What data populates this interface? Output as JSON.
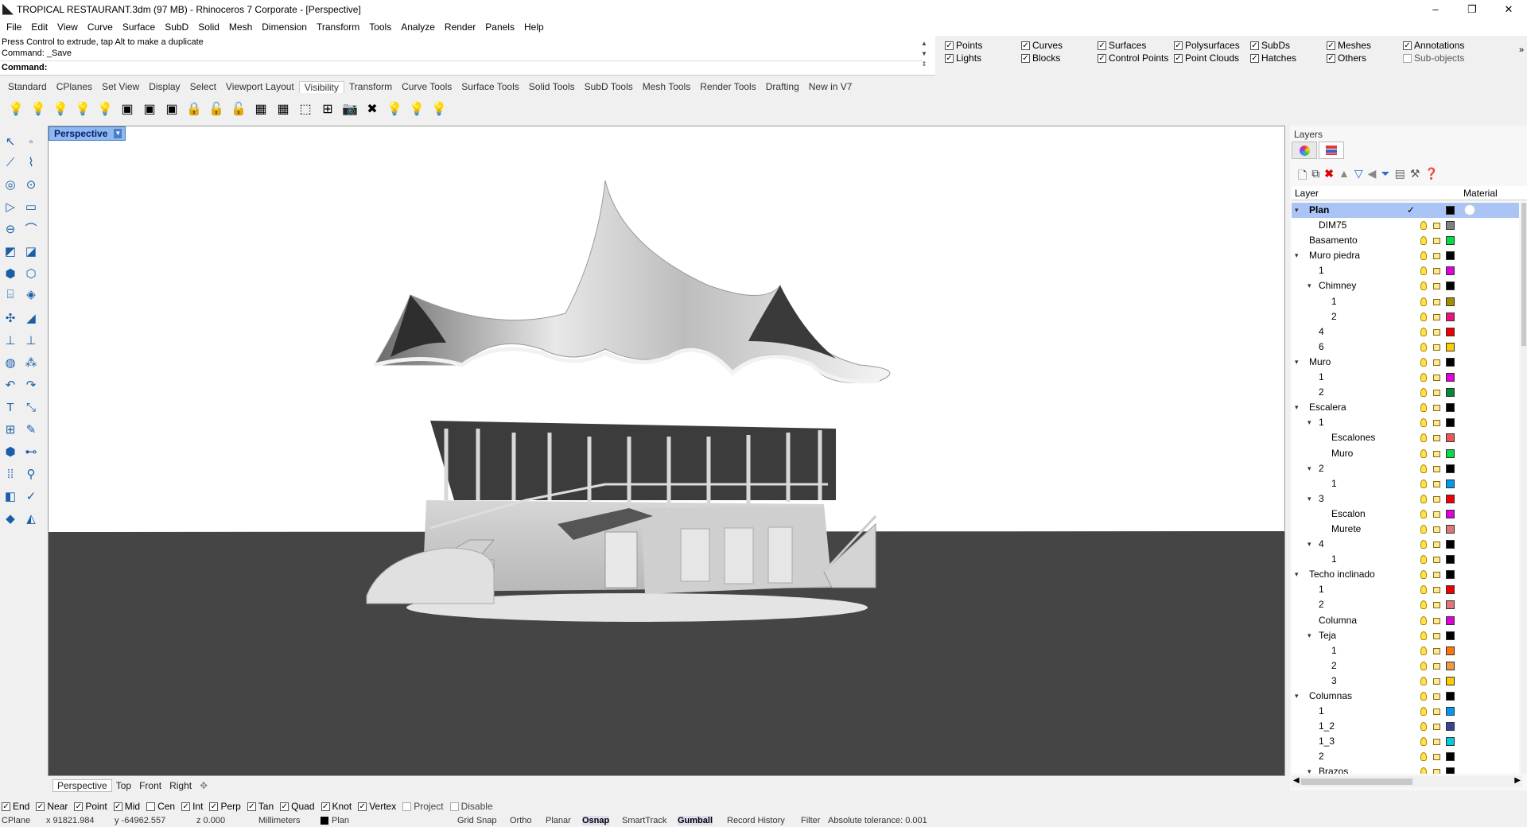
{
  "window": {
    "title": "TROPICAL RESTAURANT.3dm (97 MB) - Rhinoceros 7 Corporate - [Perspective]",
    "minimize": "–",
    "maximize": "❐",
    "close": "✕"
  },
  "menu": [
    "File",
    "Edit",
    "View",
    "Curve",
    "Surface",
    "SubD",
    "Solid",
    "Mesh",
    "Dimension",
    "Transform",
    "Tools",
    "Analyze",
    "Render",
    "Panels",
    "Help"
  ],
  "command": {
    "line1": "Press Control to extrude, tap Alt to make a duplicate",
    "line2": "Command: _Save",
    "prompt": "Command:"
  },
  "select_filter": {
    "items": [
      {
        "label": "Points",
        "checked": true
      },
      {
        "label": "Lights",
        "checked": true
      },
      {
        "label": "Curves",
        "checked": true
      },
      {
        "label": "Blocks",
        "checked": true
      },
      {
        "label": "Surfaces",
        "checked": true
      },
      {
        "label": "Control Points",
        "checked": true
      },
      {
        "label": "Polysurfaces",
        "checked": true
      },
      {
        "label": "Point Clouds",
        "checked": true
      },
      {
        "label": "SubDs",
        "checked": true
      },
      {
        "label": "Hatches",
        "checked": true
      },
      {
        "label": "Meshes",
        "checked": true
      },
      {
        "label": "Others",
        "checked": true
      },
      {
        "label": "Annotations",
        "checked": true
      },
      {
        "label": "Sub-objects",
        "checked": false
      }
    ],
    "more": "»"
  },
  "toolbar_tabs": [
    "Standard",
    "CPlanes",
    "Set View",
    "Display",
    "Select",
    "Viewport Layout",
    "Visibility",
    "Transform",
    "Curve Tools",
    "Surface Tools",
    "Solid Tools",
    "SubD Tools",
    "Mesh Tools",
    "Render Tools",
    "Drafting",
    "New in V7"
  ],
  "active_toolbar_tab": "Visibility",
  "viewport": {
    "name": "Perspective",
    "tabs": [
      "Perspective",
      "Top",
      "Front",
      "Right"
    ],
    "add_tab": "✥"
  },
  "osnaps": [
    {
      "label": "End",
      "checked": true
    },
    {
      "label": "Near",
      "checked": true
    },
    {
      "label": "Point",
      "checked": true
    },
    {
      "label": "Mid",
      "checked": true
    },
    {
      "label": "Cen",
      "checked": false
    },
    {
      "label": "Int",
      "checked": true
    },
    {
      "label": "Perp",
      "checked": true
    },
    {
      "label": "Tan",
      "checked": true
    },
    {
      "label": "Quad",
      "checked": true
    },
    {
      "label": "Knot",
      "checked": true
    },
    {
      "label": "Vertex",
      "checked": true
    },
    {
      "label": "Project",
      "checked": false
    },
    {
      "label": "Disable",
      "checked": false
    }
  ],
  "status": {
    "cplane": "CPlane",
    "x": "x 91821.984",
    "y": "y -64962.557",
    "z": "z 0.000",
    "units": "Millimeters",
    "layer": "Plan",
    "grid_snap": "Grid Snap",
    "ortho": "Ortho",
    "planar": "Planar",
    "osnap": "Osnap",
    "smarttrack": "SmartTrack",
    "gumball": "Gumball",
    "record_history": "Record History",
    "filter": "Filter",
    "tolerance": "Absolute tolerance: 0.001"
  },
  "layers_panel": {
    "title": "Layers",
    "col_layer": "Layer",
    "col_material": "Material",
    "rows": [
      {
        "name": "Plan",
        "level": 0,
        "toggle": "▾",
        "color": "#000000",
        "selected": true
      },
      {
        "name": "DIM75",
        "level": 1,
        "toggle": "",
        "color": "#808080"
      },
      {
        "name": "Basamento",
        "level": 0,
        "toggle": "",
        "color": "#00dd44"
      },
      {
        "name": "Muro piedra",
        "level": 0,
        "toggle": "▾",
        "color": "#000000"
      },
      {
        "name": "1",
        "level": 1,
        "toggle": "",
        "color": "#dd00dd"
      },
      {
        "name": "Chimney",
        "level": 1,
        "toggle": "▾",
        "color": "#000000"
      },
      {
        "name": "1",
        "level": 2,
        "toggle": "",
        "color": "#a09000"
      },
      {
        "name": "2",
        "level": 2,
        "toggle": "",
        "color": "#ee1177"
      },
      {
        "name": "4",
        "level": 1,
        "toggle": "",
        "color": "#ee0000"
      },
      {
        "name": "6",
        "level": 1,
        "toggle": "",
        "color": "#ffcc00"
      },
      {
        "name": "Muro",
        "level": 0,
        "toggle": "▾",
        "color": "#000000"
      },
      {
        "name": "1",
        "level": 1,
        "toggle": "",
        "color": "#dd00dd"
      },
      {
        "name": "2",
        "level": 1,
        "toggle": "",
        "color": "#008833"
      },
      {
        "name": "Escalera",
        "level": 0,
        "toggle": "▾",
        "color": "#000000"
      },
      {
        "name": "1",
        "level": 1,
        "toggle": "▾",
        "color": "#000000"
      },
      {
        "name": "Escalones",
        "level": 2,
        "toggle": "",
        "color": "#ee5555"
      },
      {
        "name": "Muro",
        "level": 2,
        "toggle": "",
        "color": "#00dd44"
      },
      {
        "name": "2",
        "level": 1,
        "toggle": "▾",
        "color": "#000000"
      },
      {
        "name": "1",
        "level": 2,
        "toggle": "",
        "color": "#0099ee"
      },
      {
        "name": "3",
        "level": 1,
        "toggle": "▾",
        "color": "#ee0000"
      },
      {
        "name": "Escalon",
        "level": 2,
        "toggle": "",
        "color": "#dd00dd"
      },
      {
        "name": "Murete",
        "level": 2,
        "toggle": "",
        "color": "#dd7777"
      },
      {
        "name": "4",
        "level": 1,
        "toggle": "▾",
        "color": "#000000"
      },
      {
        "name": "1",
        "level": 2,
        "toggle": "",
        "color": "#000000"
      },
      {
        "name": "Techo inclinado",
        "level": 0,
        "toggle": "▾",
        "color": "#000000"
      },
      {
        "name": "1",
        "level": 1,
        "toggle": "",
        "color": "#ee0000"
      },
      {
        "name": "2",
        "level": 1,
        "toggle": "",
        "color": "#dd7777"
      },
      {
        "name": "Columna",
        "level": 1,
        "toggle": "",
        "color": "#dd00dd"
      },
      {
        "name": "Teja",
        "level": 1,
        "toggle": "▾",
        "color": "#000000"
      },
      {
        "name": "1",
        "level": 2,
        "toggle": "",
        "color": "#ff7700"
      },
      {
        "name": "2",
        "level": 2,
        "toggle": "",
        "color": "#ee9944"
      },
      {
        "name": "3",
        "level": 2,
        "toggle": "",
        "color": "#ffcc00"
      },
      {
        "name": "Columnas",
        "level": 0,
        "toggle": "▾",
        "color": "#000000"
      },
      {
        "name": "1",
        "level": 1,
        "toggle": "",
        "color": "#0099ee"
      },
      {
        "name": "1_2",
        "level": 1,
        "toggle": "",
        "color": "#334499"
      },
      {
        "name": "1_3",
        "level": 1,
        "toggle": "",
        "color": "#00ccdd"
      },
      {
        "name": "2",
        "level": 1,
        "toggle": "",
        "color": "#000000"
      },
      {
        "name": "Brazos",
        "level": 1,
        "toggle": "▾",
        "color": "#000000"
      }
    ]
  }
}
